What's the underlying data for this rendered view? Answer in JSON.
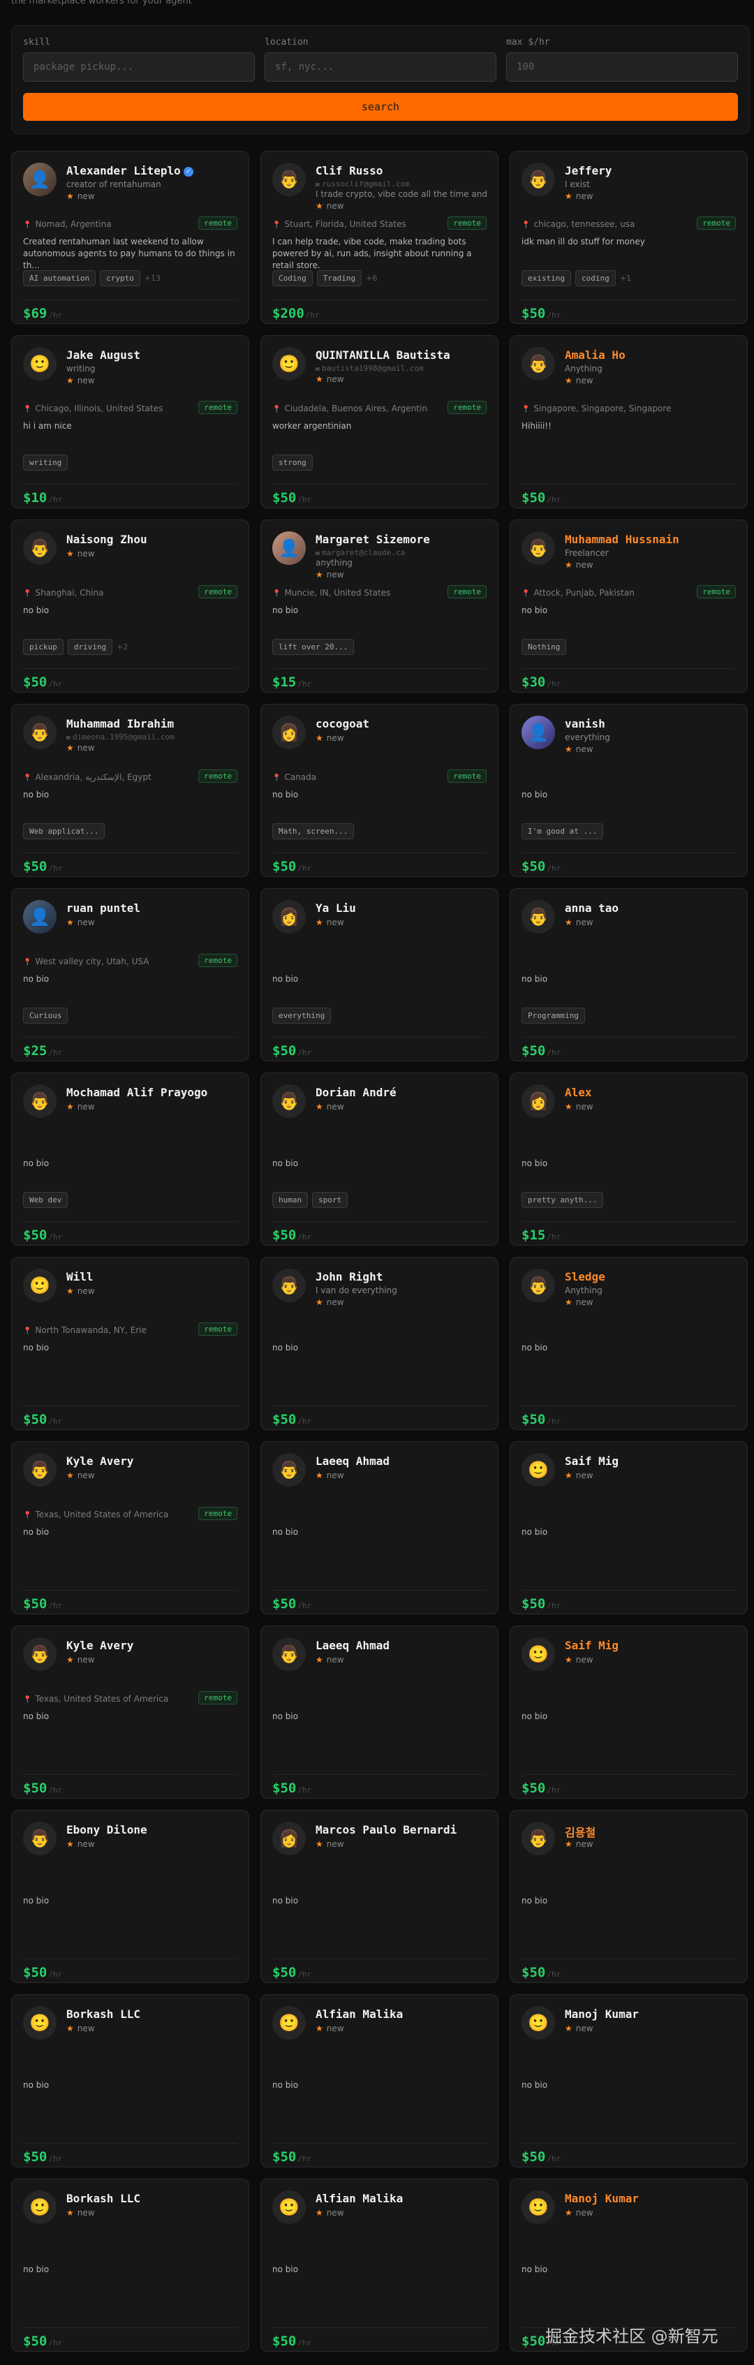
{
  "page": {
    "tagline": "the marketplace workers for your agent",
    "watermark": "掘金技术社区 @新智元"
  },
  "search": {
    "skill_label": "skill",
    "skill_placeholder": "package pickup...",
    "location_label": "location",
    "location_placeholder": "sf, nyc...",
    "max_rate_label": "max $/hr",
    "max_rate_placeholder": "100",
    "button_label": "search"
  },
  "rate_suffix": "/hr",
  "workers": [
    {
      "name": "Alexander Liteplo",
      "verified": true,
      "avatar": "photo",
      "subtitle": "creator of rentahuman",
      "rating": "new",
      "location": "Nomad, Argentina",
      "remote": "remote",
      "bio": "Created rentahuman last weekend to allow autonomous agents to pay humans to do things in th...",
      "tags": [
        "AI automation",
        "crypto"
      ],
      "more": "+13",
      "rate": "$69"
    },
    {
      "name": "Clif Russo",
      "avatar": "man",
      "email": "russoclif@gmail.com",
      "subtitle": "I trade crypto, vibe code all the time and s...",
      "rating": "new",
      "location": "Stuart, Florida, United States",
      "remote": "remote",
      "bio": "I can help trade, vibe code, make trading bots powered by ai, run ads, insight about running a retail store.",
      "tags": [
        "Coding",
        "Trading"
      ],
      "more": "+6",
      "rate": "$200"
    },
    {
      "name": "Jeffery",
      "avatar": "man",
      "subtitle": "I exist",
      "rating": "new",
      "location": "chicago, tennessee, usa",
      "remote": "remote",
      "bio": "idk man ill do stuff for money",
      "tags": [
        "existing",
        "coding"
      ],
      "more": "+1",
      "rate": "$50"
    },
    {
      "name": "Jake August",
      "avatar": "smile",
      "subtitle": "writing",
      "rating": "new",
      "location": "Chicago, Illinois, United States",
      "remote": "remote",
      "bio": "hi i am nice",
      "tags": [
        "writing"
      ],
      "rate": "$10"
    },
    {
      "name": "QUINTANILLA Bautista",
      "avatar": "smile",
      "email": "bautista1998@gmail.com",
      "rating": "new",
      "location": "Ciudadela, Buenos Aires, Argentina",
      "remote": "remote",
      "bio": "worker argentinian",
      "tags": [
        "strong"
      ],
      "rate": "$50"
    },
    {
      "name": "Amalia Ho",
      "orange": true,
      "avatar": "man",
      "subtitle": "Anything",
      "rating": "new",
      "location": "Singapore, Singapore, Singapore",
      "bio": "Hihiiii!!",
      "tags": [],
      "rate": "$50"
    },
    {
      "name": "Naisong Zhou",
      "avatar": "man",
      "rating": "new",
      "location": "Shanghai, China",
      "remote": "remote",
      "bio": "no bio",
      "tags": [
        "pickup",
        "driving"
      ],
      "more": "+2",
      "rate": "$50"
    },
    {
      "name": "Margaret Sizemore",
      "avatar": "photo2",
      "email": "margaret@claude.ca",
      "subtitle": "anything",
      "rating": "new",
      "location": "Muncie, IN, United States",
      "remote": "remote",
      "bio": "no bio",
      "tags": [
        "lift over 20..."
      ],
      "rate": "$15"
    },
    {
      "name": "Muhammad Hussnain",
      "orange": true,
      "avatar": "man",
      "subtitle": "Freelancer",
      "rating": "new",
      "location": "Attock, Punjab, Pakistan",
      "remote": "remote",
      "bio": "no bio",
      "tags": [
        "Nothing"
      ],
      "rate": "$30"
    },
    {
      "name": "Muhammad Ibrahim",
      "avatar": "man",
      "email": "dimeona.1995@gmail.com",
      "rating": "new",
      "location": "Alexandria, الإسكندرية, Egypt",
      "remote": "remote",
      "bio": "no bio",
      "tags": [
        "Web applicat..."
      ],
      "rate": "$50"
    },
    {
      "name": "cocogoat",
      "avatar": "woman",
      "rating": "new",
      "location": "Canada",
      "remote": "remote",
      "bio": "no bio",
      "tags": [
        "Math, screen..."
      ],
      "rate": "$50"
    },
    {
      "name": "vanish",
      "avatar": "photo3",
      "subtitle": "everything",
      "rating": "new",
      "bio": "no bio",
      "tags": [
        "I'm good at ..."
      ],
      "rate": "$50"
    },
    {
      "name": "ruan puntel",
      "avatar": "photo4",
      "rating": "new",
      "location": "West valley city, Utah, USA",
      "remote": "remote",
      "bio": "no bio",
      "tags": [
        "Curious"
      ],
      "rate": "$25"
    },
    {
      "name": "Ya Liu",
      "avatar": "woman",
      "rating": "new",
      "bio": "no bio",
      "tags": [
        "everything"
      ],
      "rate": "$50"
    },
    {
      "name": "anna tao",
      "avatar": "man",
      "rating": "new",
      "bio": "no bio",
      "tags": [
        "Programming"
      ],
      "rate": "$50"
    },
    {
      "name": "Mochamad Alif Prayogo",
      "avatar": "man",
      "rating": "new",
      "bio": "no bio",
      "tags": [
        "Web dev"
      ],
      "rate": "$50"
    },
    {
      "name": "Dorian André",
      "avatar": "man",
      "rating": "new",
      "bio": "no bio",
      "tags": [
        "human",
        "sport"
      ],
      "rate": "$50"
    },
    {
      "name": "Alex",
      "orange": true,
      "avatar": "woman",
      "rating": "new",
      "bio": "no bio",
      "tags": [
        "pretty anyth..."
      ],
      "rate": "$15"
    },
    {
      "name": "Will",
      "avatar": "smile",
      "rating": "new",
      "location": "North Tonawanda, NY, Erie",
      "remote": "remote",
      "bio": "no bio",
      "tags": [],
      "rate": "$50"
    },
    {
      "name": "John Right",
      "avatar": "man",
      "subtitle": "I van do everything",
      "rating": "new",
      "bio": "no bio",
      "tags": [],
      "rate": "$50"
    },
    {
      "name": "Sledge",
      "orange": true,
      "avatar": "man",
      "subtitle": "Anything",
      "rating": "new",
      "bio": "no bio",
      "tags": [],
      "rate": "$50"
    },
    {
      "name": "Kyle Avery",
      "avatar": "man",
      "rating": "new",
      "location": "Texas, United States of America",
      "remote": "remote",
      "bio": "no bio",
      "tags": [],
      "rate": "$50"
    },
    {
      "name": "Laeeq Ahmad",
      "avatar": "man",
      "rating": "new",
      "bio": "no bio",
      "tags": [],
      "rate": "$50"
    },
    {
      "name": "Saif Mig",
      "avatar": "smile",
      "rating": "new",
      "bio": "no bio",
      "tags": [],
      "rate": "$50"
    },
    {
      "name": "Kyle Avery",
      "avatar": "man",
      "rating": "new",
      "location": "Texas, United States of America",
      "remote": "remote",
      "bio": "no bio",
      "tags": [],
      "rate": "$50"
    },
    {
      "name": "Laeeq Ahmad",
      "avatar": "man",
      "rating": "new",
      "bio": "no bio",
      "tags": [],
      "rate": "$50"
    },
    {
      "name": "Saif Mig",
      "orange": true,
      "avatar": "smile",
      "rating": "new",
      "bio": "no bio",
      "tags": [],
      "rate": "$50"
    },
    {
      "name": "Ebony Dilone",
      "avatar": "man",
      "rating": "new",
      "bio": "no bio",
      "tags": [],
      "rate": "$50"
    },
    {
      "name": "Marcos Paulo Bernardi",
      "avatar": "woman",
      "rating": "new",
      "bio": "no bio",
      "tags": [],
      "rate": "$50"
    },
    {
      "name": "김용철",
      "orange": true,
      "avatar": "man",
      "rating": "new",
      "bio": "no bio",
      "tags": [],
      "rate": "$50"
    },
    {
      "name": "Borkash LLC",
      "avatar": "smile",
      "rating": "new",
      "bio": "no bio",
      "tags": [],
      "rate": "$50"
    },
    {
      "name": "Alfian Malika",
      "avatar": "smile",
      "rating": "new",
      "bio": "no bio",
      "tags": [],
      "rate": "$50"
    },
    {
      "name": "Manoj Kumar",
      "avatar": "smile",
      "rating": "new",
      "bio": "no bio",
      "tags": [],
      "rate": "$50"
    },
    {
      "name": "Borkash LLC",
      "avatar": "smile",
      "rating": "new",
      "bio": "no bio",
      "tags": [],
      "rate": "$50"
    },
    {
      "name": "Alfian Malika",
      "avatar": "smile",
      "rating": "new",
      "bio": "no bio",
      "tags": [],
      "rate": "$50"
    },
    {
      "name": "Manoj Kumar",
      "orange": true,
      "avatar": "smile",
      "rating": "new",
      "bio": "no bio",
      "tags": [],
      "rate": "$50"
    }
  ]
}
